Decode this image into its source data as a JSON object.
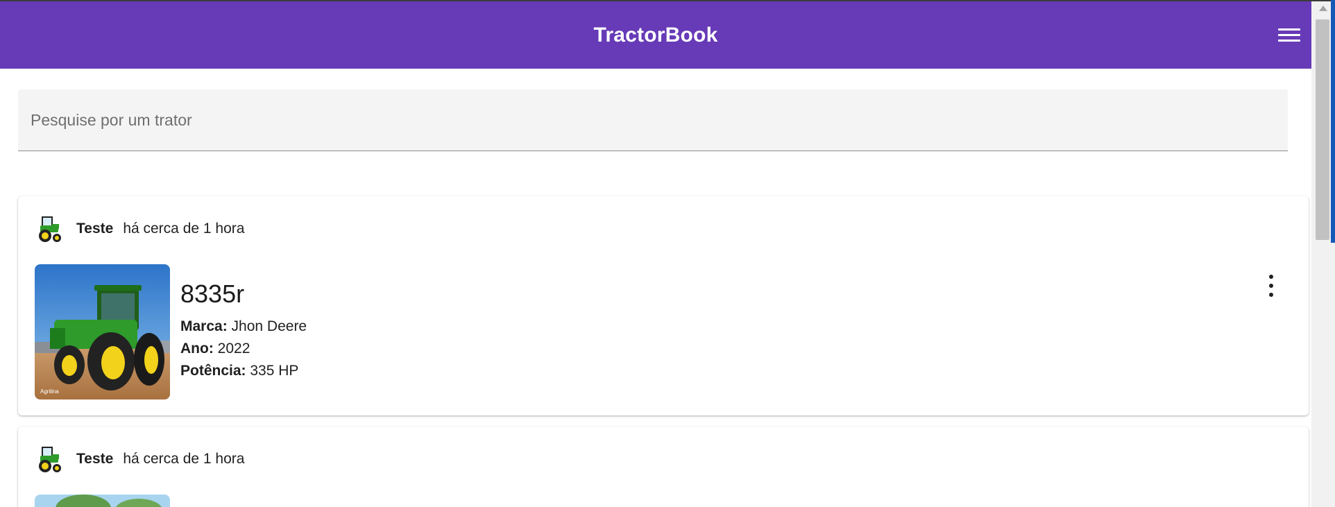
{
  "app": {
    "title": "TractorBook"
  },
  "search": {
    "placeholder": "Pesquise por um trator"
  },
  "posts": [
    {
      "user": "Teste",
      "time": "há cerca de 1 hora",
      "model": "8335r",
      "brand_label": "Marca:",
      "brand": "Jhon Deere",
      "year_label": "Ano:",
      "year": "2022",
      "power_label": "Potência:",
      "power": "335 HP",
      "image_caption": "Agrilina"
    },
    {
      "user": "Teste",
      "time": "há cerca de 1 hora"
    }
  ],
  "icons": {
    "menu": "menu-icon",
    "more": "more-vert-icon",
    "avatar": "tractor-avatar-icon"
  },
  "colors": {
    "appbar": "#673ab7",
    "tractor_green": "#2e9b2b",
    "tractor_yellow": "#f2d21a"
  }
}
